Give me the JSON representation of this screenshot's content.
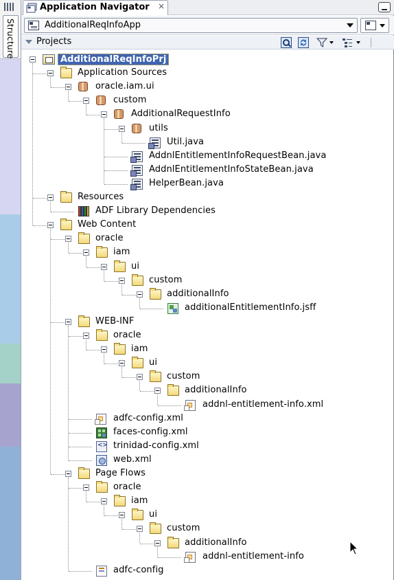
{
  "side_panel": {
    "tab_label": "Structure"
  },
  "window": {
    "title": "Application Navigator",
    "close_glyph": "×"
  },
  "app_selector": {
    "value": "AdditionalReqInfoApp"
  },
  "projects_header": {
    "label": "Projects"
  },
  "tree": [
    {
      "label": "AdditionalReqInfoPrj",
      "icon": "project-icon",
      "depth": 0,
      "expander": true,
      "selected": true
    },
    {
      "label": "Application Sources",
      "icon": "folder-icon",
      "depth": 1,
      "expander": true
    },
    {
      "label": "oracle.iam.ui",
      "icon": "package-icon",
      "depth": 2,
      "expander": true
    },
    {
      "label": "custom",
      "icon": "package-icon",
      "depth": 3,
      "expander": true
    },
    {
      "label": "AdditionalRequestInfo",
      "icon": "package-icon",
      "depth": 4,
      "expander": true
    },
    {
      "label": "utils",
      "icon": "package-icon",
      "depth": 5,
      "expander": true
    },
    {
      "label": "Util.java",
      "icon": "java-file-icon",
      "depth": 6,
      "expander": false
    },
    {
      "label": "AddnlEntitlementInfoRequestBean.java",
      "icon": "java-file-icon",
      "depth": 5,
      "expander": false
    },
    {
      "label": "AddnlEntitlementInfoStateBean.java",
      "icon": "java-file-icon",
      "depth": 5,
      "expander": false
    },
    {
      "label": "HelperBean.java",
      "icon": "java-file-icon",
      "depth": 5,
      "expander": false
    },
    {
      "label": "Resources",
      "icon": "folder-icon",
      "depth": 1,
      "expander": true
    },
    {
      "label": "ADF Library Dependencies",
      "icon": "library-icon",
      "depth": 2,
      "expander": false
    },
    {
      "label": "Web Content",
      "icon": "folder-icon",
      "depth": 1,
      "expander": true
    },
    {
      "label": "oracle",
      "icon": "folder-icon",
      "depth": 2,
      "expander": true
    },
    {
      "label": "iam",
      "icon": "folder-icon",
      "depth": 3,
      "expander": true
    },
    {
      "label": "ui",
      "icon": "folder-icon",
      "depth": 4,
      "expander": true
    },
    {
      "label": "custom",
      "icon": "folder-icon",
      "depth": 5,
      "expander": true
    },
    {
      "label": "additionalInfo",
      "icon": "folder-icon",
      "depth": 6,
      "expander": true
    },
    {
      "label": "additionalEntitlementInfo.jsff",
      "icon": "jsff-file-icon",
      "depth": 7,
      "expander": false
    },
    {
      "label": "WEB-INF",
      "icon": "folder-icon",
      "depth": 2,
      "expander": true
    },
    {
      "label": "oracle",
      "icon": "folder-icon",
      "depth": 3,
      "expander": true
    },
    {
      "label": "iam",
      "icon": "folder-icon",
      "depth": 4,
      "expander": true
    },
    {
      "label": "ui",
      "icon": "folder-icon",
      "depth": 5,
      "expander": true
    },
    {
      "label": "custom",
      "icon": "folder-icon",
      "depth": 6,
      "expander": true
    },
    {
      "label": "additionalInfo",
      "icon": "folder-icon",
      "depth": 7,
      "expander": true
    },
    {
      "label": "addnl-entitlement-info.xml",
      "icon": "xml-file-icon",
      "depth": 8,
      "expander": false
    },
    {
      "label": "adfc-config.xml",
      "icon": "xml-file-icon",
      "depth": 3,
      "expander": false
    },
    {
      "label": "faces-config.xml",
      "icon": "faces-config-icon",
      "depth": 3,
      "expander": false
    },
    {
      "label": "trinidad-config.xml",
      "icon": "trinidad-config-icon",
      "depth": 3,
      "expander": false
    },
    {
      "label": "web.xml",
      "icon": "web-xml-icon",
      "depth": 3,
      "expander": false
    },
    {
      "label": "Page Flows",
      "icon": "folder-icon",
      "depth": 2,
      "expander": true
    },
    {
      "label": "oracle",
      "icon": "folder-icon",
      "depth": 3,
      "expander": true
    },
    {
      "label": "iam",
      "icon": "folder-icon",
      "depth": 4,
      "expander": true
    },
    {
      "label": "ui",
      "icon": "folder-icon",
      "depth": 5,
      "expander": true
    },
    {
      "label": "custom",
      "icon": "folder-icon",
      "depth": 6,
      "expander": true
    },
    {
      "label": "additionalInfo",
      "icon": "folder-icon",
      "depth": 7,
      "expander": true
    },
    {
      "label": "addnl-entitlement-info",
      "icon": "xml-file-icon",
      "depth": 8,
      "expander": false
    },
    {
      "label": "adfc-config",
      "icon": "adfc-config-icon",
      "depth": 3,
      "expander": false
    }
  ]
}
